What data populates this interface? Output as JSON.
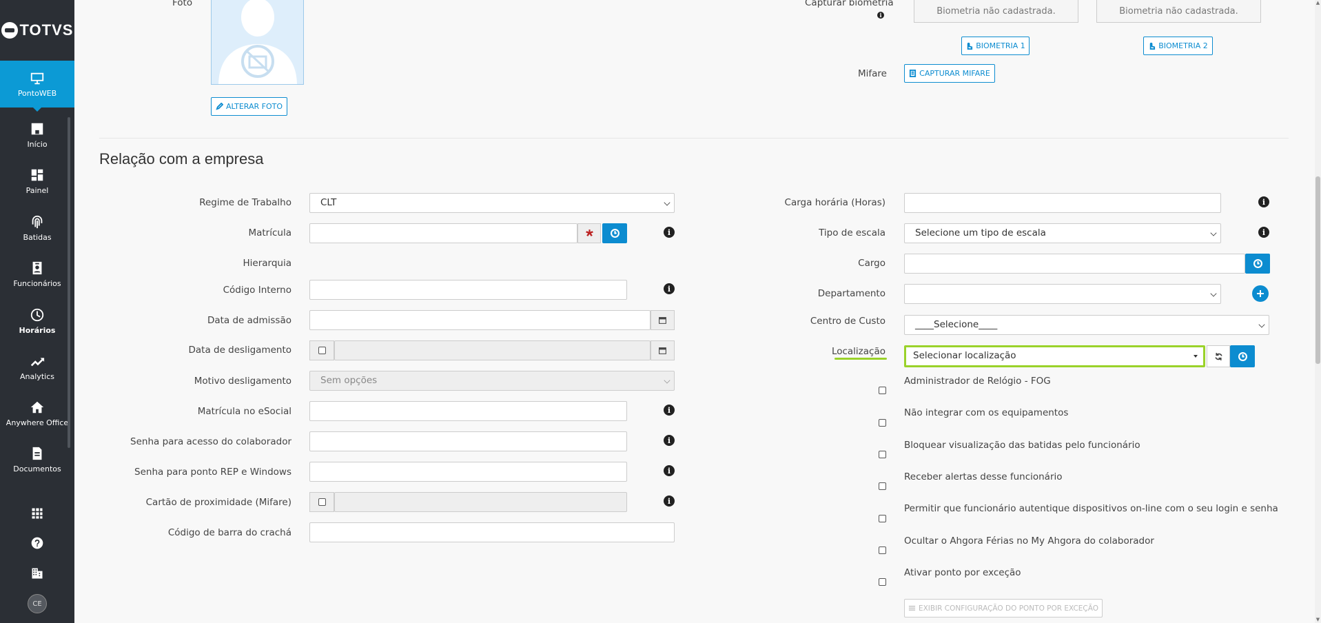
{
  "brand": {
    "logo_text": "TOTVS"
  },
  "sidebar": {
    "active": {
      "label": "PontoWEB",
      "icon": "monitor-icon"
    },
    "items": [
      {
        "label": "Início",
        "icon": "home-icon"
      },
      {
        "label": "Painel",
        "icon": "dashboard-icon"
      },
      {
        "label": "Batidas",
        "icon": "fingerprint-icon"
      },
      {
        "label": "Funcionários",
        "icon": "badge-icon"
      },
      {
        "label": "Horários",
        "icon": "clock-icon"
      },
      {
        "label": "Analytics",
        "icon": "trend-icon"
      },
      {
        "label": "Anywhere Office",
        "icon": "house-office-icon"
      },
      {
        "label": "Documentos",
        "icon": "document-icon"
      }
    ],
    "bottom_icons": [
      "apps-grid-icon",
      "help-icon",
      "building-icon"
    ],
    "avatar_initials": "CE"
  },
  "photo": {
    "label": "Foto",
    "change_button": "ALTERAR FOTO"
  },
  "biometry": {
    "label": "Capturar biometria",
    "box1": "Biometria não cadastrada.",
    "box2": "Biometria não cadastrada.",
    "button1": "BIOMETRIA 1",
    "button2": "BIOMETRIA 2",
    "mifare_label": "Mifare",
    "mifare_button": "CAPTURAR MIFARE"
  },
  "section": {
    "title": "Relação com a empresa"
  },
  "left_form": {
    "regime_label": "Regime de Trabalho",
    "regime_value": "CLT",
    "matricula_label": "Matrícula",
    "hierarquia_label": "Hierarquia",
    "codigo_interno_label": "Código Interno",
    "data_admissao_label": "Data de admissão",
    "data_desligamento_label": "Data de desligamento",
    "motivo_label": "Motivo desligamento",
    "motivo_value": "Sem opções",
    "esocial_label": "Matrícula no eSocial",
    "senha_colab_label": "Senha para acesso do colaborador",
    "senha_rep_label": "Senha para ponto REP e Windows",
    "cartao_label": "Cartão de proximidade (Mifare)",
    "codigo_barra_label": "Código de barra do crachá"
  },
  "right_form": {
    "carga_label": "Carga horária (Horas)",
    "escala_label": "Tipo de escala",
    "escala_value": "Selecione um tipo de escala",
    "cargo_label": "Cargo",
    "departamento_label": "Departamento",
    "centro_label": "Centro de Custo",
    "centro_value": "____Selecione____",
    "localizacao_label": "Localização",
    "localizacao_value": "Selecionar localização"
  },
  "checkboxes": [
    "Administrador de Relógio - FOG",
    "Não integrar com os equipamentos",
    "Bloquear visualização das batidas pelo funcionário",
    "Receber alertas desse funcionário",
    "Permitir que funcionário autentique dispositivos on-line com o seu login e senha",
    "Ocultar o Ahgora Férias no My Ahgora do colaborador",
    "Ativar ponto por exceção"
  ],
  "exception_button": "EXIBIR CONFIGURAÇÃO DO PONTO POR EXCEÇÃO",
  "colors": {
    "primary": "#0c8cd0",
    "sidebar": "#2b2f35",
    "active": "#0c9ad5",
    "highlight": "#9ad22a"
  }
}
